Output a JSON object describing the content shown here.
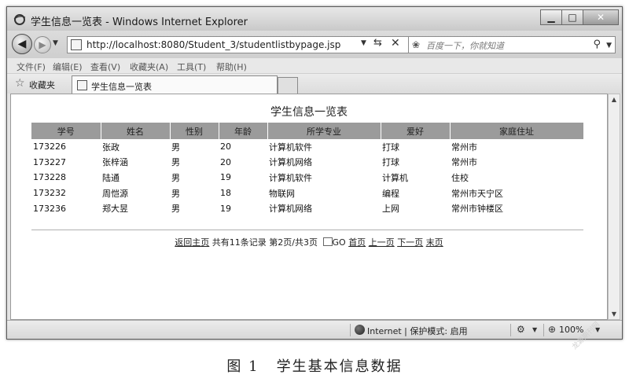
{
  "window": {
    "title": "学生信息一览表 - Windows Internet Explorer",
    "controls": {
      "minimize": "▁",
      "maximize": "□",
      "close": "✕"
    }
  },
  "navigation": {
    "url": "http://localhost:8080/Student_3/studentlistbypage.jsp",
    "search_placeholder": "百度一下，你就知道"
  },
  "menu": [
    "文件(F)",
    "编辑(E)",
    "查看(V)",
    "收藏夹(A)",
    "工具(T)",
    "帮助(H)"
  ],
  "favorites": {
    "label": "收藏夹",
    "tab_label": "学生信息一览表"
  },
  "page": {
    "title": "学生信息一览表",
    "table": {
      "headers": [
        "学号",
        "姓名",
        "性别",
        "年龄",
        "所学专业",
        "爱好",
        "家庭住址"
      ],
      "rows": [
        [
          "173226",
          "张政",
          "男",
          "20",
          "计算机软件",
          "打球",
          "常州市"
        ],
        [
          "173227",
          "张梓涵",
          "男",
          "20",
          "计算机网络",
          "打球",
          "常州市"
        ],
        [
          "173228",
          "陆通",
          "男",
          "19",
          "计算机软件",
          "计算机",
          "住校"
        ],
        [
          "173232",
          "周恺源",
          "男",
          "18",
          "物联网",
          "编程",
          "常州市天宁区"
        ],
        [
          "173236",
          "郑大昱",
          "男",
          "19",
          "计算机网络",
          "上网",
          "常州市钟楼区"
        ]
      ]
    },
    "pager": {
      "home_link": "返回主页",
      "total_text": "共有11条记录",
      "page_text": "第2页/共3页",
      "go_label": "GO",
      "first_link": "首页",
      "prev_link": "上一页",
      "next_link": "下一页",
      "last_link": "末页"
    }
  },
  "status": {
    "zone": "Internet | 保护模式: 启用",
    "zoom": "100%"
  },
  "figure": {
    "caption_number": "图 1",
    "caption_text": "学生基本信息数据"
  },
  "watermark": "龙源期刊网"
}
